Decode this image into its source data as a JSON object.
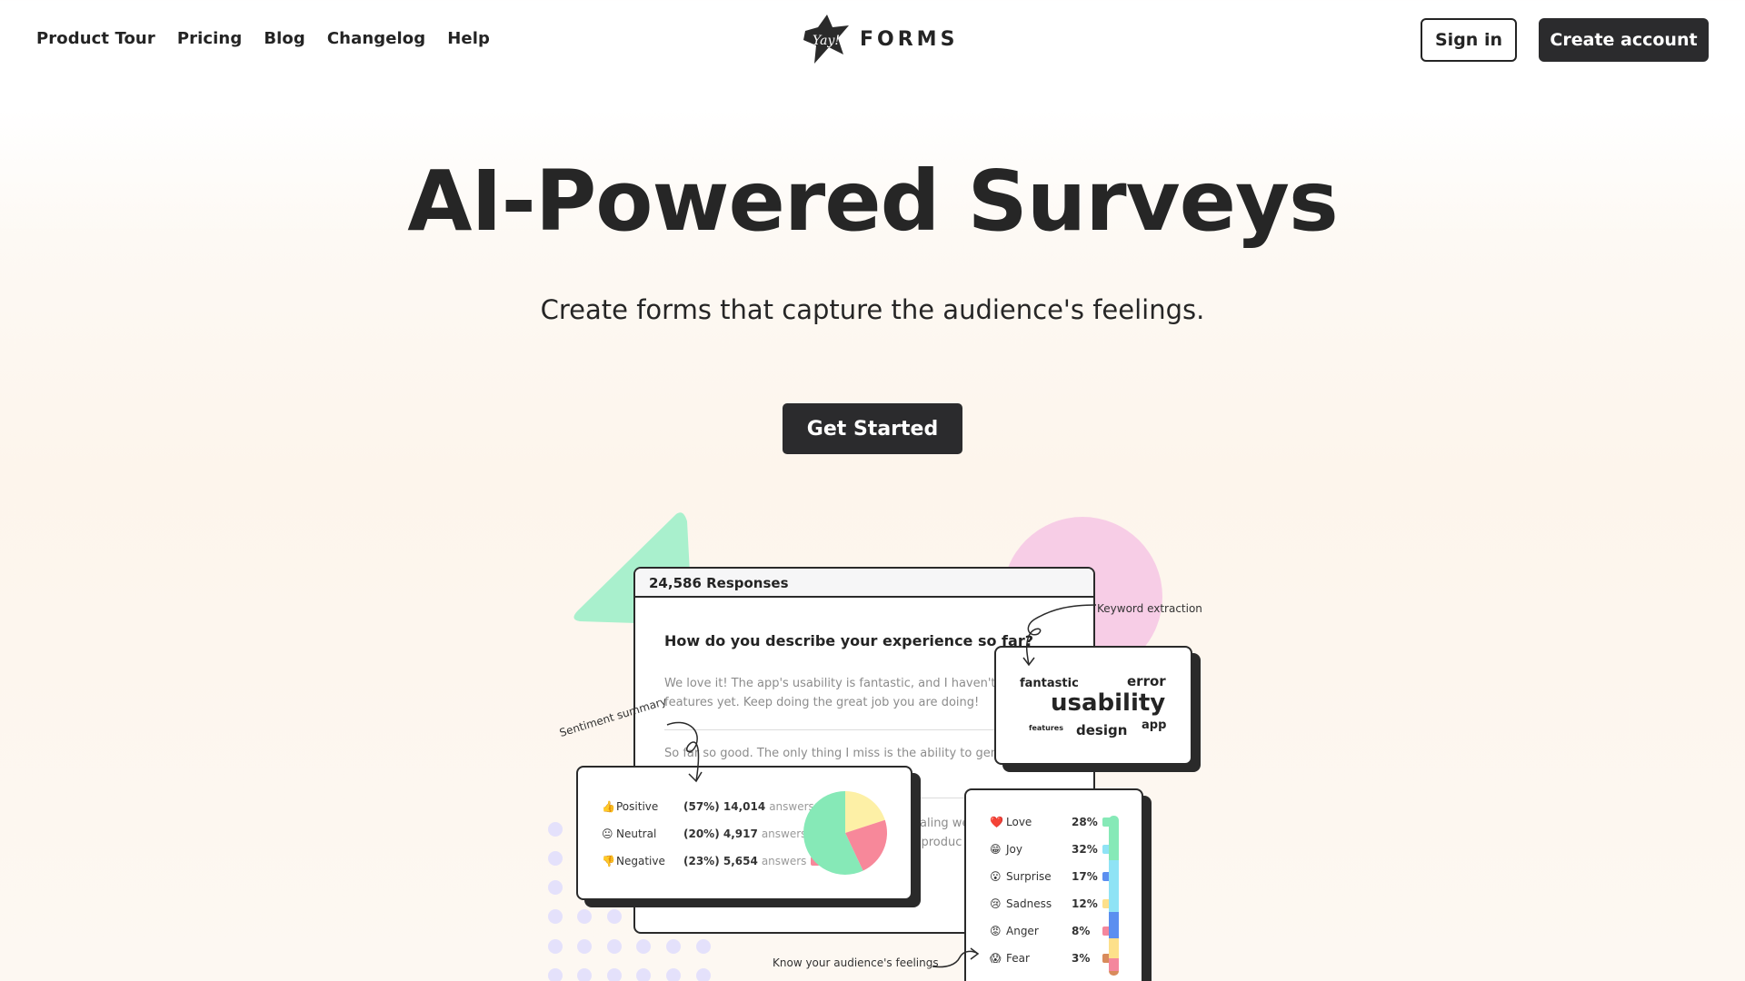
{
  "nav": {
    "links": [
      "Product Tour",
      "Pricing",
      "Blog",
      "Changelog",
      "Help"
    ],
    "logo_mark_text": "Yay!",
    "logo_word": "FORMS",
    "sign_in": "Sign in",
    "create_account": "Create account"
  },
  "hero": {
    "title": "AI-Powered Surveys",
    "subtitle": "Create forms that capture the audience's feelings.",
    "cta": "Get Started"
  },
  "survey": {
    "responses": "24,586 Responses",
    "question": "How do you describe your experience so far?",
    "answers": [
      "We love it! The app's usability is fantastic, and I haven't miss",
      "features yet. Keep doing the great job you are doing!",
      "So far so good. The only thing I miss is the ability to generat",
      "ealing we",
      "r produc"
    ]
  },
  "annotations": {
    "sentiment_summary": "Sentiment summary",
    "keyword_extraction": "Keyword extraction",
    "know_feelings": "Know your audience's feelings"
  },
  "sentiment": [
    {
      "emoji": "👍",
      "label": "Positive",
      "value": "(57%) 14,014",
      "unit": "answers",
      "color": "#86e9b7",
      "share": 57
    },
    {
      "emoji": "😐",
      "label": "Neutral",
      "value": "(20%) 4,917",
      "unit": "answers",
      "color": "#fdf0a6",
      "share": 20
    },
    {
      "emoji": "👎",
      "label": "Negative",
      "value": "(23%) 5,654",
      "unit": "answers",
      "color": "#f7889a",
      "share": 23
    }
  ],
  "keywords": [
    "fantastic",
    "error",
    "usability",
    "features",
    "design",
    "app"
  ],
  "emotions": [
    {
      "emoji": "❤️",
      "label": "Love",
      "pct": "28%",
      "color": "#86e9b7",
      "share": 28
    },
    {
      "emoji": "😁",
      "label": "Joy",
      "pct": "32%",
      "color": "#8fe3f5",
      "share": 32
    },
    {
      "emoji": "😮",
      "label": "Surprise",
      "pct": "17%",
      "color": "#5b8ff0",
      "share": 17
    },
    {
      "emoji": "😢",
      "label": "Sadness",
      "pct": "12%",
      "color": "#fde08a",
      "share": 12
    },
    {
      "emoji": "😡",
      "label": "Anger",
      "pct": "8%",
      "color": "#f4879d",
      "share": 8
    },
    {
      "emoji": "😱",
      "label": "Fear",
      "pct": "3%",
      "color": "#d98b5c",
      "share": 3
    }
  ]
}
